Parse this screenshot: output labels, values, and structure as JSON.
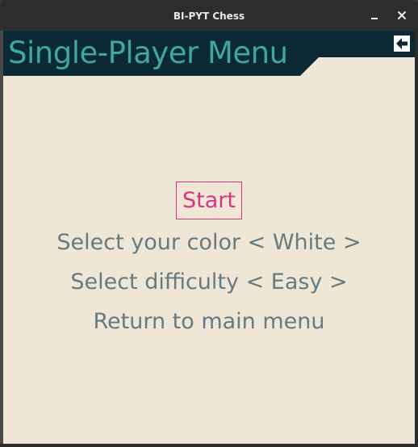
{
  "window": {
    "title": "BI-PYT Chess"
  },
  "titlebar_buttons": {
    "minimize_icon": "minimize-icon",
    "close_glyph": "✕"
  },
  "header": {
    "title": "Single-Player Menu",
    "back_icon": "arrow-left-icon"
  },
  "menu": {
    "start_label": "Start",
    "color_label": "Select your color < White >",
    "difficulty_label": "Select difficulty < Easy >",
    "return_label": "Return to main menu"
  },
  "colors": {
    "background": "#efe6d6",
    "banner": "#0b2a36",
    "title_text": "#3fa7a0",
    "menu_text": "#657b83",
    "selected_text": "#d33682"
  }
}
